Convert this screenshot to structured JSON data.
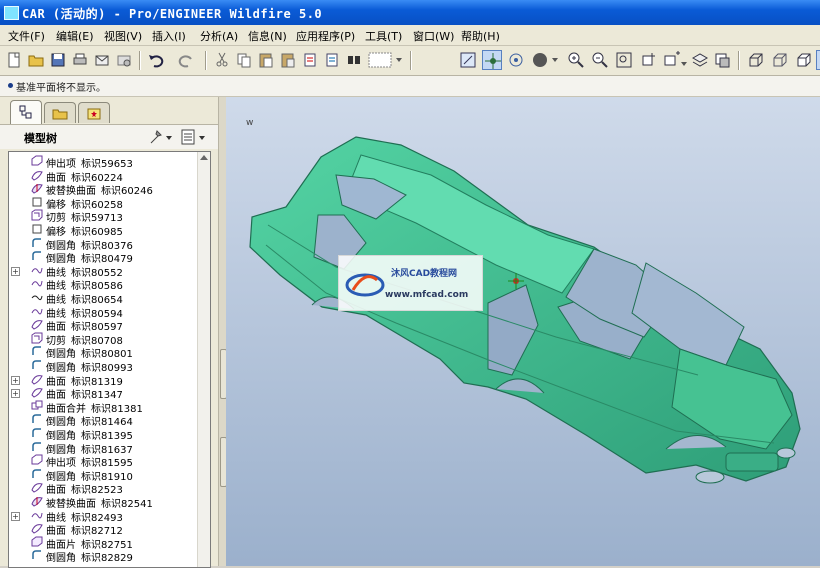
{
  "window": {
    "title": "CAR (活动的) - Pro/ENGINEER Wildfire 5.0"
  },
  "menu": [
    "文件(F)",
    "编辑(E)",
    "视图(V)",
    "插入(I)",
    "分析(A)",
    "信息(N)",
    "应用程序(P)",
    "工具(T)",
    "窗口(W)",
    "帮助(H)"
  ],
  "toolbar_icons": [
    "new-file-icon",
    "open-folder-icon",
    "save-icon",
    "print-icon",
    "send-mail-icon",
    "mail-attachment-icon",
    "undo-icon",
    "redo-icon",
    "cut-icon",
    "copy-icon",
    "paste-icon",
    "paste-special-icon",
    "regenerate-icon",
    "regen-manager-icon",
    "find-icon",
    "selection-box-icon",
    "repaint-icon",
    "spin-center-icon",
    "orient-mode-icon",
    "appearance-sphere-icon",
    "zoom-in-icon",
    "zoom-out-icon",
    "refit-icon",
    "reorient-icon",
    "saved-views-icon",
    "layers-icon",
    "view-manager-icon",
    "wireframe-icon",
    "hidden-line-icon",
    "no-hidden-icon",
    "shading-icon"
  ],
  "message": "基准平面将不显示。",
  "navigator": {
    "tree_title": "模型树",
    "tab_icons": [
      "model-tree-tab-icon",
      "folder-browser-tab-icon",
      "favorites-tab-icon"
    ]
  },
  "model_tree": [
    {
      "name": "伸出项",
      "id": "标识59653",
      "icon": "extrude-icon",
      "expand": false
    },
    {
      "name": "曲面",
      "id": "标识60224",
      "icon": "surface-icon",
      "expand": false
    },
    {
      "name": "被替换曲面",
      "id": "标识60246",
      "icon": "replaced-surface-icon",
      "expand": false
    },
    {
      "name": "偏移",
      "id": "标识60258",
      "icon": "offset-icon",
      "expand": false
    },
    {
      "name": "切剪",
      "id": "标识59713",
      "icon": "cut-feature-icon",
      "expand": false
    },
    {
      "name": "偏移",
      "id": "标识60985",
      "icon": "offset-icon",
      "expand": false
    },
    {
      "name": "倒圆角",
      "id": "标识80376",
      "icon": "round-icon",
      "expand": false
    },
    {
      "name": "倒圆角",
      "id": "标识80479",
      "icon": "round-icon",
      "expand": false
    },
    {
      "name": "曲线",
      "id": "标识80552",
      "icon": "curve-icon",
      "expand": true
    },
    {
      "name": "曲线",
      "id": "标识80586",
      "icon": "curve-icon",
      "expand": false
    },
    {
      "name": "曲线",
      "id": "标识80654",
      "icon": "curve-line-icon",
      "expand": false
    },
    {
      "name": "曲线",
      "id": "标识80594",
      "icon": "curve-icon",
      "expand": false
    },
    {
      "name": "曲面",
      "id": "标识80597",
      "icon": "surface-icon",
      "expand": false
    },
    {
      "name": "切剪",
      "id": "标识80708",
      "icon": "cut-feature-icon",
      "expand": false
    },
    {
      "name": "倒圆角",
      "id": "标识80801",
      "icon": "round-icon",
      "expand": false
    },
    {
      "name": "倒圆角",
      "id": "标识80993",
      "icon": "round-icon",
      "expand": false
    },
    {
      "name": "曲面",
      "id": "标识81319",
      "icon": "surface-icon",
      "expand": true
    },
    {
      "name": "曲面",
      "id": "标识81347",
      "icon": "surface-icon",
      "expand": true
    },
    {
      "name": "曲面合并",
      "id": "标识81381",
      "icon": "merge-icon",
      "expand": false
    },
    {
      "name": "倒圆角",
      "id": "标识81464",
      "icon": "round-icon",
      "expand": false
    },
    {
      "name": "倒圆角",
      "id": "标识81395",
      "icon": "round-icon",
      "expand": false
    },
    {
      "name": "倒圆角",
      "id": "标识81637",
      "icon": "round-icon",
      "expand": false
    },
    {
      "name": "伸出项",
      "id": "标识81595",
      "icon": "extrude-icon",
      "expand": false
    },
    {
      "name": "倒圆角",
      "id": "标识81910",
      "icon": "round-icon",
      "expand": false
    },
    {
      "name": "曲面",
      "id": "标识82523",
      "icon": "surface-icon",
      "expand": false
    },
    {
      "name": "被替换曲面",
      "id": "标识82541",
      "icon": "replaced-surface-icon",
      "expand": false
    },
    {
      "name": "曲线",
      "id": "标识82493",
      "icon": "curve-icon",
      "expand": true
    },
    {
      "name": "曲面",
      "id": "标识82712",
      "icon": "surface-icon",
      "expand": false
    },
    {
      "name": "曲面片",
      "id": "标识82751",
      "icon": "patch-icon",
      "expand": false
    },
    {
      "name": "倒圆角",
      "id": "标识82829",
      "icon": "round-icon",
      "expand": false
    }
  ],
  "watermark": {
    "line1": "沐风CAD教程网",
    "line2": "www.mfcad.com",
    "prefix": "w"
  },
  "colors": {
    "model": "#3fbf92",
    "viewport_top": "#cfdaea",
    "viewport_bottom": "#9bb0cc",
    "titlebar": "#0a5bd6"
  }
}
